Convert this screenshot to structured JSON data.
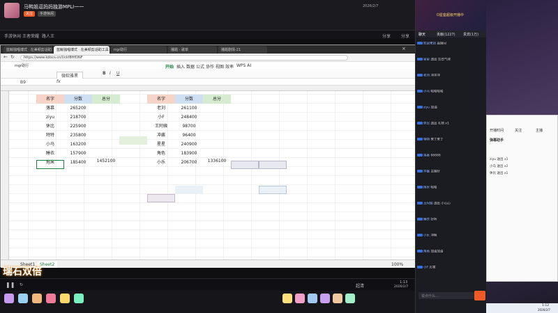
{
  "stream": {
    "title": "马鸭姐逗妈妈独游MPLI一一",
    "follow_label": "关注",
    "category_label": "手游休闲",
    "nav": [
      "手游休闲",
      "王者荣耀",
      "路人王"
    ],
    "counter": "2026/2/7",
    "right_links": [
      "分享",
      "分享"
    ]
  },
  "browser": {
    "tabs": [
      "蓝鲸独唱博式 · 在美顿剪话助工具",
      "蓝鲸独唱博式 · 在美顿剪话助工具",
      "rrgr助行",
      "播题 - 歌单",
      "播题剧情-21"
    ],
    "active_tab": 1,
    "url": "https://www.kdocs.cn/l/ckf8HfDNF",
    "doc_title": "mgr助行",
    "menu": [
      "开始",
      "插入",
      "数据",
      "公式",
      "协作",
      "视图",
      "效率",
      "WPS AI"
    ],
    "font_name": "微软雅黑",
    "cell_ref": "B9"
  },
  "sheet": {
    "table1": {
      "headers": [
        "名字",
        "分数",
        "总分"
      ],
      "rows": [
        [
          "落慕",
          "265200"
        ],
        [
          "ziyu",
          "218700"
        ],
        [
          "休比",
          "225900"
        ],
        [
          "特特",
          "235800"
        ],
        [
          "小马",
          "163200"
        ],
        [
          "睡衣",
          "157900"
        ],
        [
          "拖米",
          "185400"
        ]
      ],
      "total": "1452100"
    },
    "table2": {
      "headers": [
        "名字",
        "分数",
        "总分"
      ],
      "rows": [
        [
          "老刘",
          "261100"
        ],
        [
          "小F",
          "248400"
        ],
        [
          "王阿姨",
          "98700"
        ],
        [
          "冲酱",
          "96400"
        ],
        [
          "星星",
          "240900"
        ],
        [
          "角色",
          "183900"
        ],
        [
          "小乐",
          "206700"
        ]
      ],
      "total": "1336100"
    },
    "sheet_tabs": [
      "Sheet1",
      "Sheet2"
    ],
    "zoom": "100%"
  },
  "overlay": {
    "text": "瑞石双倍"
  },
  "player": {
    "time": "1:13",
    "date": "2026/2/7",
    "quality": "超清"
  },
  "chat": {
    "header": "O星座超级开播中",
    "tabs": [
      "聊天",
      "贡献(1227)",
      "贵宾(1万)"
    ],
    "lines": [
      {
        "user": "欢迎来到",
        "text": "直播间"
      },
      {
        "user": "星星",
        "text": "送出 告白气球"
      },
      {
        "user": "老刘",
        "text": "冲冲冲"
      },
      {
        "user": "小马",
        "text": "哈哈哈哈"
      },
      {
        "user": "ziyu",
        "text": "加油"
      },
      {
        "user": "休比",
        "text": "送出 礼物 x1"
      },
      {
        "user": "特特",
        "text": "来了来了"
      },
      {
        "user": "落慕",
        "text": "66666"
      },
      {
        "user": "冲酱",
        "text": "主播好"
      },
      {
        "user": "拖米",
        "text": "哈哈"
      },
      {
        "user": "王阿姨",
        "text": "送出 小心心"
      },
      {
        "user": "睡衣",
        "text": "好听"
      },
      {
        "user": "小乐",
        "text": "冲啊"
      },
      {
        "user": "角色",
        "text": "加油加油"
      },
      {
        "user": "小F",
        "text": "厉害"
      }
    ],
    "input_placeholder": "说点什么..."
  },
  "rightwin": {
    "tabs": [
      "开播时间",
      "关注",
      "主播"
    ],
    "title": "弹幕助手",
    "items": [
      "ziyu 送出 x1",
      "小马 送出 x2",
      "休比 送出 x1"
    ]
  },
  "taskbar": {
    "time": "1:12",
    "date": "2026/2/7"
  },
  "colors": {
    "header_red": "#f6d4c8",
    "header_blue": "#cfe0f3",
    "header_green": "#d6ecd0",
    "accent": "#f05a28"
  }
}
